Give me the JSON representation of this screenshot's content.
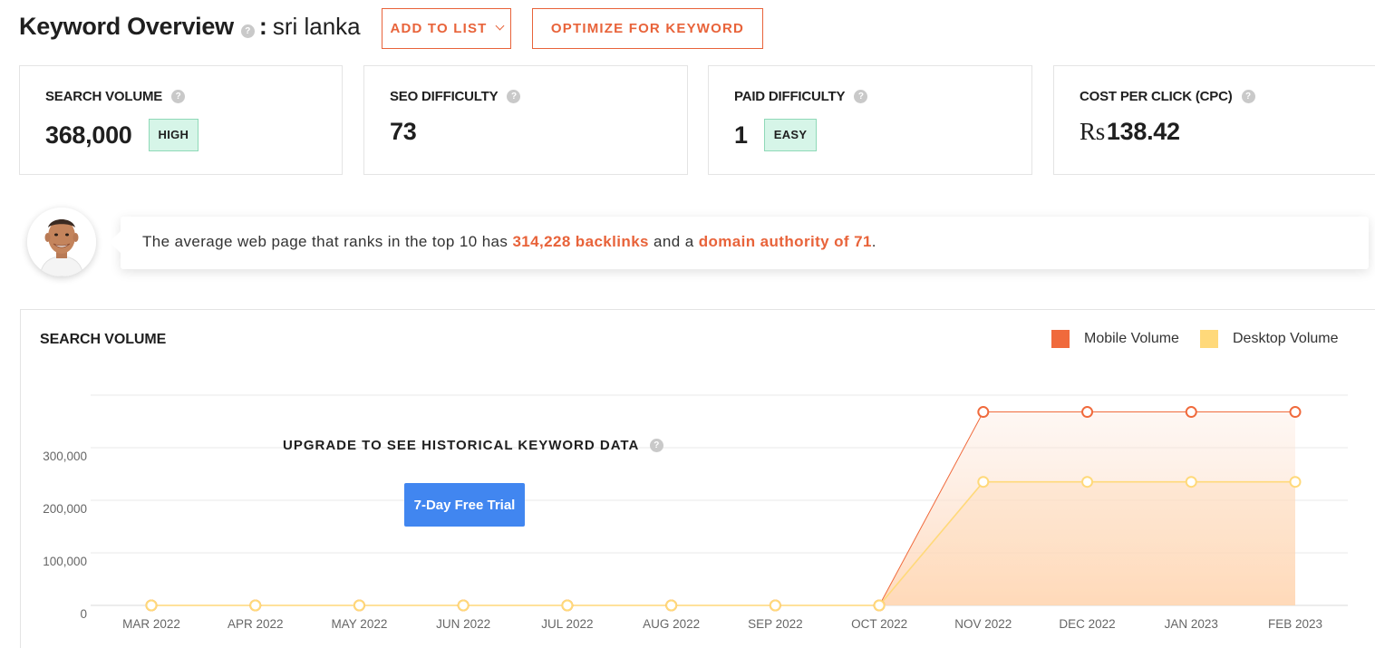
{
  "header": {
    "title": "Keyword Overview",
    "help_glyph": "?",
    "colon": ":",
    "keyword": "sri lanka",
    "add_to_list_label": "ADD TO LIST",
    "optimize_label": "OPTIMIZE FOR KEYWORD"
  },
  "metrics": [
    {
      "label": "SEARCH VOLUME",
      "value": "368,000",
      "badge": "HIGH"
    },
    {
      "label": "SEO DIFFICULTY",
      "value": "73"
    },
    {
      "label": "PAID DIFFICULTY",
      "value": "1",
      "badge": "EASY"
    },
    {
      "label": "COST PER CLICK (CPC)",
      "currency": "Rs",
      "value": "138.42"
    }
  ],
  "tip": {
    "text_before": "The average web page that ranks in the top 10 has ",
    "backlinks": "314,228 backlinks",
    "text_middle": " and a ",
    "authority": "domain authority of 71",
    "text_after": "."
  },
  "search_volume_panel": {
    "title": "SEARCH VOLUME",
    "upgrade_text": "UPGRADE TO SEE HISTORICAL KEYWORD DATA",
    "trial_button": "7-Day Free Trial"
  },
  "colors": {
    "accent": "#e8633a",
    "mobile": "#f06a3c",
    "desktop": "#ffd97a",
    "trial_blue": "#4186f0",
    "badge_green": "#d6f5e8"
  },
  "chart_data": {
    "type": "line",
    "title": "SEARCH VOLUME",
    "categories": [
      "MAR 2022",
      "APR 2022",
      "MAY 2022",
      "JUN 2022",
      "JUL 2022",
      "AUG 2022",
      "SEP 2022",
      "OCT 2022",
      "NOV 2022",
      "DEC 2022",
      "JAN 2023",
      "FEB 2023"
    ],
    "series": [
      {
        "name": "Mobile Volume",
        "color": "#f06a3c",
        "values": [
          0,
          0,
          0,
          0,
          0,
          0,
          0,
          0,
          368000,
          368000,
          368000,
          368000
        ]
      },
      {
        "name": "Desktop Volume",
        "color": "#ffd97a",
        "values": [
          0,
          0,
          0,
          0,
          0,
          0,
          0,
          0,
          235000,
          235000,
          235000,
          235000
        ]
      }
    ],
    "yticks": [
      "0",
      "100,000",
      "200,000",
      "300,000"
    ],
    "ylim": [
      0,
      400000
    ],
    "legend_position": "top-right",
    "grid": true
  }
}
